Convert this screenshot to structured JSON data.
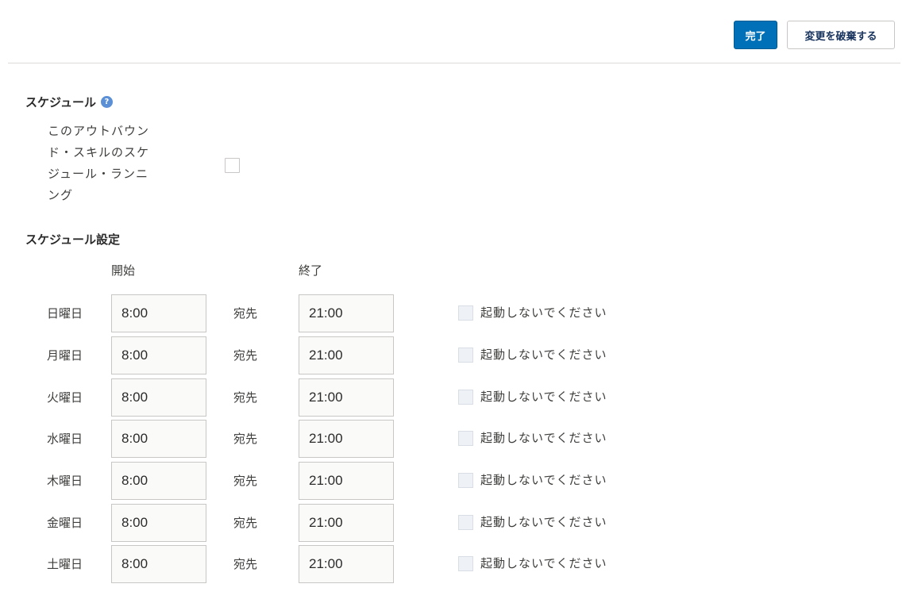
{
  "toolbar": {
    "done_label": "完了",
    "discard_label": "変更を破棄する"
  },
  "schedule": {
    "title": "スケジュール",
    "help_icon": "help-icon",
    "enable_label": "このアウトバウンド・スキルのスケジュール・ランニング",
    "enable_checked": false
  },
  "settings": {
    "title": "スケジュール設定",
    "start_header": "開始",
    "end_header": "終了",
    "rows": [
      {
        "day": "日曜日",
        "start": "8:00",
        "to": "宛先",
        "end": "21:00",
        "skip_label": "起動しないでください",
        "skip_checked": false
      },
      {
        "day": "月曜日",
        "start": "8:00",
        "to": "宛先",
        "end": "21:00",
        "skip_label": "起動しないでください",
        "skip_checked": false
      },
      {
        "day": "火曜日",
        "start": "8:00",
        "to": "宛先",
        "end": "21:00",
        "skip_label": "起動しないでください",
        "skip_checked": false
      },
      {
        "day": "水曜日",
        "start": "8:00",
        "to": "宛先",
        "end": "21:00",
        "skip_label": "起動しないでください",
        "skip_checked": false
      },
      {
        "day": "木曜日",
        "start": "8:00",
        "to": "宛先",
        "end": "21:00",
        "skip_label": "起動しないでください",
        "skip_checked": false
      },
      {
        "day": "金曜日",
        "start": "8:00",
        "to": "宛先",
        "end": "21:00",
        "skip_label": "起動しないでください",
        "skip_checked": false
      },
      {
        "day": "土曜日",
        "start": "8:00",
        "to": "宛先",
        "end": "21:00",
        "skip_label": "起動しないでください",
        "skip_checked": false
      }
    ]
  }
}
